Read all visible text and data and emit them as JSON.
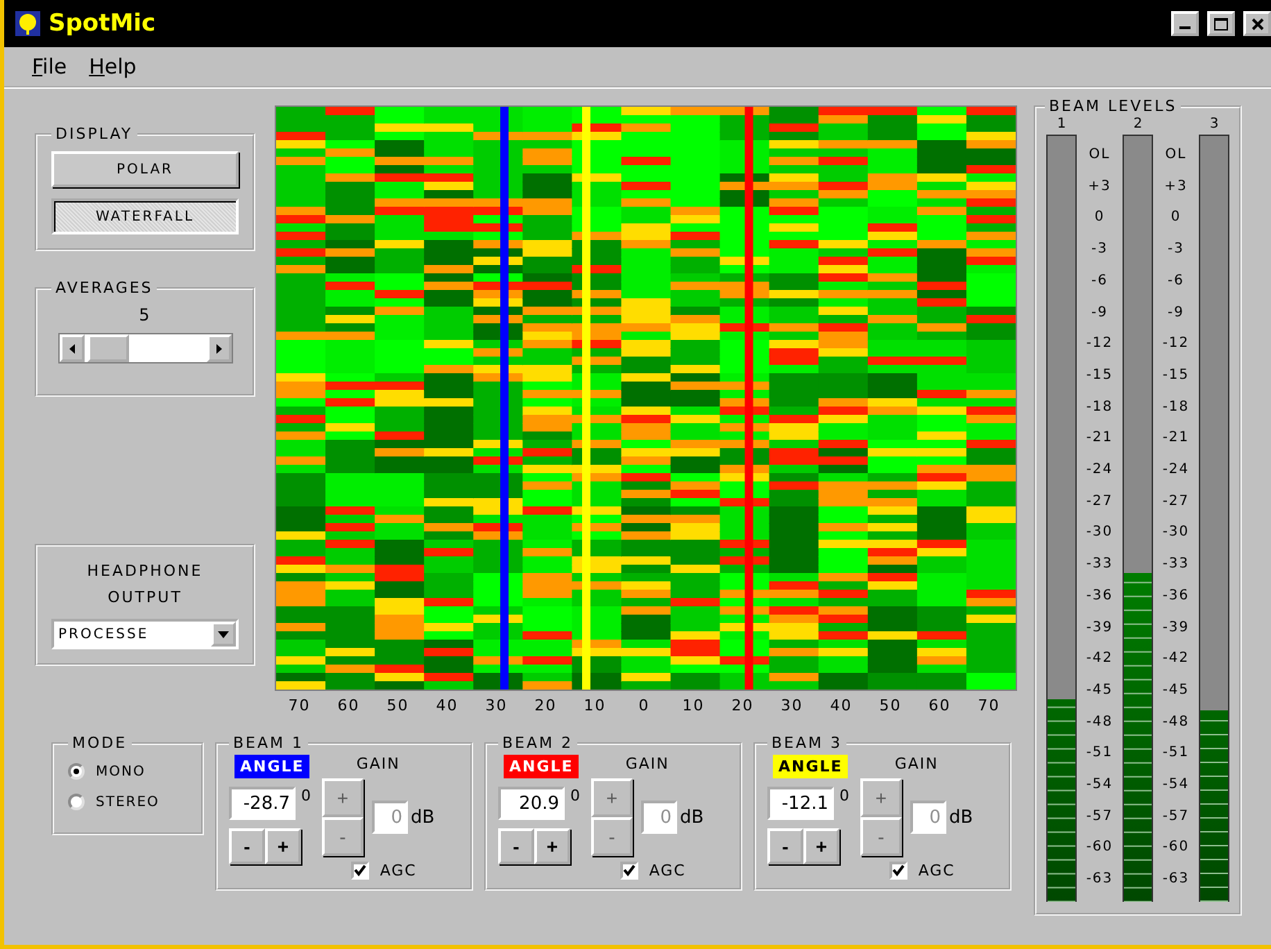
{
  "window": {
    "title": "SpotMic"
  },
  "menu": [
    {
      "label": "File"
    },
    {
      "label": "Help"
    }
  ],
  "display": {
    "title": "DISPLAY",
    "buttons": [
      {
        "label": "POLAR",
        "selected": false
      },
      {
        "label": "WATERFALL",
        "selected": true
      }
    ]
  },
  "averages": {
    "title": "AVERAGES",
    "value": "5"
  },
  "headphone": {
    "title": "HEADPHONE OUTPUT",
    "value": "PROCESSE"
  },
  "waterfall": {
    "axis": [
      "70",
      "60",
      "50",
      "40",
      "30",
      "20",
      "10",
      "0",
      "10",
      "20",
      "30",
      "40",
      "50",
      "60",
      "70"
    ]
  },
  "mode": {
    "title": "MODE",
    "options": [
      {
        "label": "MONO",
        "selected": true
      },
      {
        "label": "STEREO",
        "selected": false
      }
    ]
  },
  "beams": [
    {
      "title": "BEAM 1",
      "angle_label": "ANGLE",
      "color": "#0000ff",
      "angle": "-28.7",
      "degree": "0",
      "minus": "-",
      "plus": "+",
      "gain_label": "GAIN",
      "gain_up": "+",
      "gain_down": "-",
      "gain": "0",
      "unit": "dB",
      "gain_disabled": true,
      "agc_label": "AGC",
      "agc": true
    },
    {
      "title": "BEAM 2",
      "angle_label": "ANGLE",
      "color": "#ff0000",
      "angle": "20.9",
      "degree": "0",
      "minus": "-",
      "plus": "+",
      "gain_label": "GAIN",
      "gain_up": "+",
      "gain_down": "-",
      "gain": "0",
      "unit": "dB",
      "gain_disabled": true,
      "agc_label": "AGC",
      "agc": true
    },
    {
      "title": "BEAM 3",
      "angle_label": "ANGLE",
      "color": "#ffff00",
      "angle": "-12.1",
      "degree": "0",
      "minus": "-",
      "plus": "+",
      "gain_label": "GAIN",
      "gain_up": "+",
      "gain_down": "-",
      "gain": "0",
      "unit": "dB",
      "gain_disabled": true,
      "agc_label": "AGC",
      "agc": true
    }
  ],
  "levels": {
    "title": "BEAM LEVELS",
    "meters": [
      {
        "label": "1",
        "level": 0.265
      },
      {
        "label": "2",
        "level": 0.43
      },
      {
        "label": "3",
        "level": 0.25
      }
    ],
    "scales": [
      [
        "OL",
        "+3",
        "0",
        "-3",
        "-6",
        "-9",
        "-12",
        "-15",
        "-18",
        "-21",
        "-24",
        "-27",
        "-30",
        "-33",
        "-36",
        "-39",
        "-42",
        "-45",
        "-48",
        "-51",
        "-54",
        "-57",
        "-60",
        "-63"
      ],
      [
        "OL",
        "+3",
        "0",
        "-3",
        "-6",
        "-9",
        "-12",
        "-15",
        "-18",
        "-21",
        "-24",
        "-27",
        "-30",
        "-33",
        "-36",
        "-39",
        "-42",
        "-45",
        "-48",
        "-51",
        "-54",
        "-57",
        "-60",
        "-63"
      ]
    ]
  }
}
